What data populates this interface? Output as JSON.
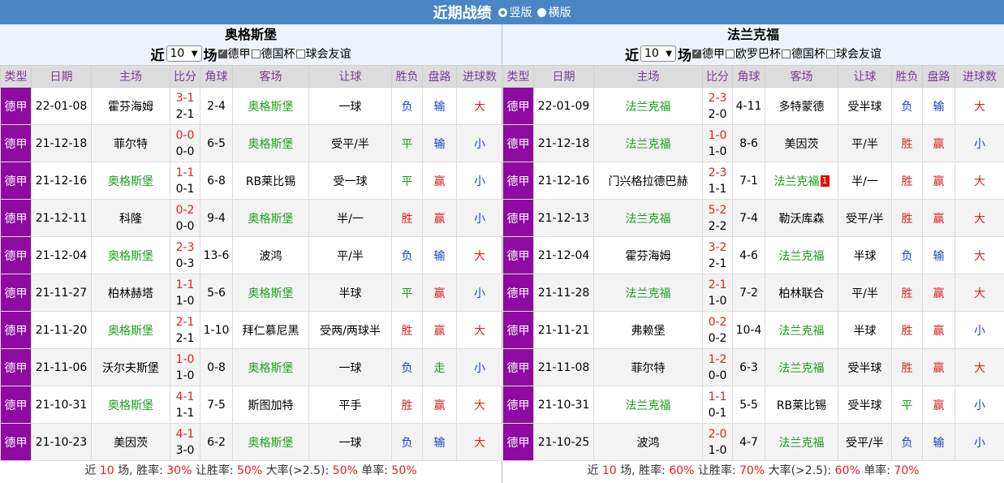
{
  "page": {
    "title": "近期战绩",
    "layout_vertical": "竖版",
    "layout_horizontal": "横版"
  },
  "columns": [
    "类型",
    "日期",
    "主场",
    "比分",
    "角球",
    "客场",
    "让球",
    "胜负",
    "盘路",
    "进球数"
  ],
  "left": {
    "team": "奥格斯堡",
    "near_prefix": "近",
    "near_suffix": "场",
    "count": "10",
    "filters": [
      {
        "label": "德甲",
        "checked": true
      },
      {
        "label": "德国杯",
        "checked": false
      },
      {
        "label": "球会友谊",
        "checked": false
      }
    ],
    "rows": [
      {
        "league": "德甲",
        "date": "22-01-08",
        "home": "霍芬海姆",
        "home_hl": false,
        "ft": "3-1",
        "ht": "2-1",
        "corner": "2-4",
        "away": "奥格斯堡",
        "away_hl": true,
        "handicap": "一球",
        "result": "负",
        "pan": "输",
        "goals": "大"
      },
      {
        "league": "德甲",
        "date": "21-12-18",
        "home": "菲尔特",
        "home_hl": false,
        "ft": "0-0",
        "ht": "0-0",
        "corner": "6-5",
        "away": "奥格斯堡",
        "away_hl": true,
        "handicap": "受平/半",
        "result": "平",
        "pan": "输",
        "goals": "小"
      },
      {
        "league": "德甲",
        "date": "21-12-16",
        "home": "奥格斯堡",
        "home_hl": true,
        "ft": "1-1",
        "ht": "0-1",
        "corner": "6-8",
        "away": "RB莱比锡",
        "away_hl": false,
        "handicap": "受一球",
        "result": "平",
        "pan": "赢",
        "goals": "小"
      },
      {
        "league": "德甲",
        "date": "21-12-11",
        "home": "科隆",
        "home_hl": false,
        "ft": "0-2",
        "ht": "0-0",
        "corner": "9-4",
        "away": "奥格斯堡",
        "away_hl": true,
        "handicap": "半/一",
        "result": "胜",
        "pan": "赢",
        "goals": "小"
      },
      {
        "league": "德甲",
        "date": "21-12-04",
        "home": "奥格斯堡",
        "home_hl": true,
        "ft": "2-3",
        "ht": "0-3",
        "corner": "13-6",
        "away": "波鸿",
        "away_hl": false,
        "handicap": "平/半",
        "result": "负",
        "pan": "输",
        "goals": "大"
      },
      {
        "league": "德甲",
        "date": "21-11-27",
        "home": "柏林赫塔",
        "home_hl": false,
        "ft": "1-1",
        "ht": "1-0",
        "corner": "5-6",
        "away": "奥格斯堡",
        "away_hl": true,
        "handicap": "半球",
        "result": "平",
        "pan": "赢",
        "goals": "小"
      },
      {
        "league": "德甲",
        "date": "21-11-20",
        "home": "奥格斯堡",
        "home_hl": true,
        "ft": "2-1",
        "ht": "2-1",
        "corner": "1-10",
        "away": "拜仁慕尼黑",
        "away_hl": false,
        "handicap": "受两/两球半",
        "result": "胜",
        "pan": "赢",
        "goals": "大"
      },
      {
        "league": "德甲",
        "date": "21-11-06",
        "home": "沃尔夫斯堡",
        "home_hl": false,
        "ft": "1-0",
        "ht": "1-0",
        "corner": "0-8",
        "away": "奥格斯堡",
        "away_hl": true,
        "handicap": "一球",
        "result": "负",
        "pan": "走",
        "goals": "小"
      },
      {
        "league": "德甲",
        "date": "21-10-31",
        "home": "奥格斯堡",
        "home_hl": true,
        "ft": "4-1",
        "ht": "1-1",
        "corner": "7-5",
        "away": "斯图加特",
        "away_hl": false,
        "handicap": "平手",
        "result": "胜",
        "pan": "赢",
        "goals": "大"
      },
      {
        "league": "德甲",
        "date": "21-10-23",
        "home": "美因茨",
        "home_hl": false,
        "ft": "4-1",
        "ht": "3-0",
        "corner": "6-2",
        "away": "奥格斯堡",
        "away_hl": true,
        "handicap": "一球",
        "result": "负",
        "pan": "输",
        "goals": "大"
      }
    ],
    "summary": {
      "t1": "近 ",
      "n": "10",
      "t2": " 场, 胜率: ",
      "win": "30%",
      "t3": " 让胜率: ",
      "hwin": "50%",
      "t4": " 大率(>2.5): ",
      "big": "50%",
      "t5": " 单率: ",
      "odd": "50%"
    }
  },
  "right": {
    "team": "法兰克福",
    "near_prefix": "近",
    "near_suffix": "场",
    "count": "10",
    "filters": [
      {
        "label": "德甲",
        "checked": true
      },
      {
        "label": "欧罗巴杯",
        "checked": false
      },
      {
        "label": "德国杯",
        "checked": false
      },
      {
        "label": "球会友谊",
        "checked": false
      }
    ],
    "rows": [
      {
        "league": "德甲",
        "date": "22-01-09",
        "home": "法兰克福",
        "home_hl": true,
        "ft": "2-3",
        "ht": "2-0",
        "corner": "4-11",
        "away": "多特蒙德",
        "away_hl": false,
        "handicap": "受半球",
        "result": "负",
        "pan": "输",
        "goals": "大"
      },
      {
        "league": "德甲",
        "date": "21-12-18",
        "home": "法兰克福",
        "home_hl": true,
        "ft": "1-0",
        "ht": "1-0",
        "corner": "8-6",
        "away": "美因茨",
        "away_hl": false,
        "handicap": "平/半",
        "result": "胜",
        "pan": "赢",
        "goals": "小"
      },
      {
        "league": "德甲",
        "date": "21-12-16",
        "home": "门兴格拉德巴赫",
        "home_hl": false,
        "ft": "2-3",
        "ht": "1-1",
        "corner": "7-1",
        "away": "法兰克福",
        "away_hl": true,
        "away_card": "1",
        "handicap": "半/一",
        "result": "胜",
        "pan": "赢",
        "goals": "大"
      },
      {
        "league": "德甲",
        "date": "21-12-13",
        "home": "法兰克福",
        "home_hl": true,
        "ft": "5-2",
        "ht": "2-2",
        "corner": "7-4",
        "away": "勒沃库森",
        "away_hl": false,
        "handicap": "受平/半",
        "result": "胜",
        "pan": "赢",
        "goals": "大"
      },
      {
        "league": "德甲",
        "date": "21-12-04",
        "home": "霍芬海姆",
        "home_hl": false,
        "ft": "3-2",
        "ht": "2-1",
        "corner": "4-6",
        "away": "法兰克福",
        "away_hl": true,
        "handicap": "半球",
        "result": "负",
        "pan": "输",
        "goals": "大"
      },
      {
        "league": "德甲",
        "date": "21-11-28",
        "home": "法兰克福",
        "home_hl": true,
        "ft": "2-1",
        "ht": "1-0",
        "corner": "7-2",
        "away": "柏林联合",
        "away_hl": false,
        "handicap": "平/半",
        "result": "胜",
        "pan": "赢",
        "goals": "大"
      },
      {
        "league": "德甲",
        "date": "21-11-21",
        "home": "弗赖堡",
        "home_hl": false,
        "ft": "0-2",
        "ht": "0-2",
        "corner": "10-4",
        "away": "法兰克福",
        "away_hl": true,
        "handicap": "半球",
        "result": "胜",
        "pan": "赢",
        "goals": "小"
      },
      {
        "league": "德甲",
        "date": "21-11-08",
        "home": "菲尔特",
        "home_hl": false,
        "ft": "1-2",
        "ht": "0-0",
        "corner": "6-3",
        "away": "法兰克福",
        "away_hl": true,
        "handicap": "受半球",
        "result": "胜",
        "pan": "赢",
        "goals": "大"
      },
      {
        "league": "德甲",
        "date": "21-10-31",
        "home": "法兰克福",
        "home_hl": true,
        "ft": "1-1",
        "ht": "0-1",
        "corner": "5-5",
        "away": "RB莱比锡",
        "away_hl": false,
        "handicap": "受半球",
        "result": "平",
        "pan": "赢",
        "goals": "小"
      },
      {
        "league": "德甲",
        "date": "21-10-25",
        "home": "波鸿",
        "home_hl": false,
        "ft": "2-0",
        "ht": "1-0",
        "corner": "4-7",
        "away": "法兰克福",
        "away_hl": true,
        "handicap": "受平/半",
        "result": "负",
        "pan": "输",
        "goals": "小"
      }
    ],
    "summary": {
      "t1": "近 ",
      "n": "10",
      "t2": " 场, 胜率: ",
      "win": "60%",
      "t3": " 让胜率: ",
      "hwin": "70%",
      "t4": " 大率(>2.5): ",
      "big": "60%",
      "t5": " 单率: ",
      "odd": "70%"
    }
  },
  "colors": {
    "header_bar": "#4a86c5",
    "league_cell": "#8e0aa0",
    "highlight_team": "#1a9f1a",
    "score": "#e02020",
    "win": "#e02020",
    "draw": "#1a9f1a",
    "lose": "#1c3fc9",
    "pan_win": "#e02020",
    "pan_lose": "#1c3fc9",
    "pan_push": "#1a9f1a",
    "goals_big": "#e02020",
    "goals_small": "#1c3fc9"
  }
}
